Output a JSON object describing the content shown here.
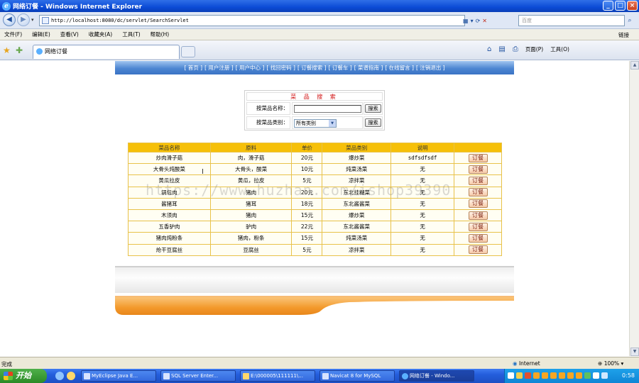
{
  "window": {
    "title": "网络订餐 - Windows Internet Explorer",
    "min": "_",
    "max": "□",
    "close": "×"
  },
  "address": {
    "url": "http://localhost:8080/dc/servlet/SearchServlet",
    "search_placeholder": "百度"
  },
  "menu": {
    "items": [
      "文件(F)",
      "编辑(E)",
      "查看(V)",
      "收藏夹(A)",
      "工具(T)",
      "帮助(H)"
    ],
    "links_label": "链接"
  },
  "tabs": {
    "active_title": "网络订餐",
    "page_label": "页面(P)",
    "tools_label": "工具(O)"
  },
  "site_nav": {
    "items": [
      "[ 首页 ]",
      "[ 用户注册 ]",
      "[ 用户中心 ]",
      "[ 找回密码 ]",
      "[ 订餐搜索 ]",
      "[ 订餐车 ]",
      "[ 菜谱指南 ]",
      "[ 在线留言 ]",
      "[ 注销退出 ]"
    ]
  },
  "search_panel": {
    "title": "菜 品 搜 索",
    "name_label": "按菜品名称：",
    "name_value": "",
    "category_label": "按菜品类别：",
    "category_value": "所有类别",
    "search_button": "搜索"
  },
  "table": {
    "headers": [
      "菜品名称",
      "原料",
      "单价",
      "菜品类别",
      "说明",
      ""
    ],
    "order_label": "订餐",
    "rows": [
      [
        "炒肉滑子菇",
        "肉，滑子菇",
        "20元",
        "爆炒菜",
        "sdfsdfsdf"
      ],
      [
        "大骨头炖酸菜",
        "大骨头，酸菜",
        "10元",
        "炖菜汤菜",
        "无"
      ],
      [
        "黄瓜拉皮",
        "黄瓜，拉皮",
        "5元",
        "凉拌菜",
        "无"
      ],
      [
        "锅包肉",
        "猪肉",
        "20元",
        "东北挂糊菜",
        "无"
      ],
      [
        "酱猪耳",
        "猪耳",
        "18元",
        "东北酱酱菜",
        "无"
      ],
      [
        "木须肉",
        "猪肉",
        "15元",
        "爆炒菜",
        "无"
      ],
      [
        "五香驴肉",
        "驴肉",
        "22元",
        "东北酱酱菜",
        "无"
      ],
      [
        "猪肉炖粉条",
        "猪肉，粉条",
        "15元",
        "炖菜汤菜",
        "无"
      ],
      [
        "炝干豆腐丝",
        "豆腐丝",
        "5元",
        "凉拌菜",
        "无"
      ]
    ]
  },
  "watermark": "https://www.huzhan.com/ishop39390",
  "status": {
    "text": "完成",
    "zone": "Internet",
    "zoom": "100%"
  },
  "taskbar": {
    "start": "开始",
    "items": [
      "MyEclipse Java E...",
      "SQL Server Enter...",
      "E:\\000005\\111111\\...",
      "Navicat 8 for MySQL",
      "网络订餐 - Windo..."
    ],
    "clock": "0:58"
  },
  "colors": {
    "nav_blue": "#4d86d2",
    "table_header": "#f6c009",
    "accent_orange": "#f39a2c",
    "title_red": "#d01010"
  }
}
